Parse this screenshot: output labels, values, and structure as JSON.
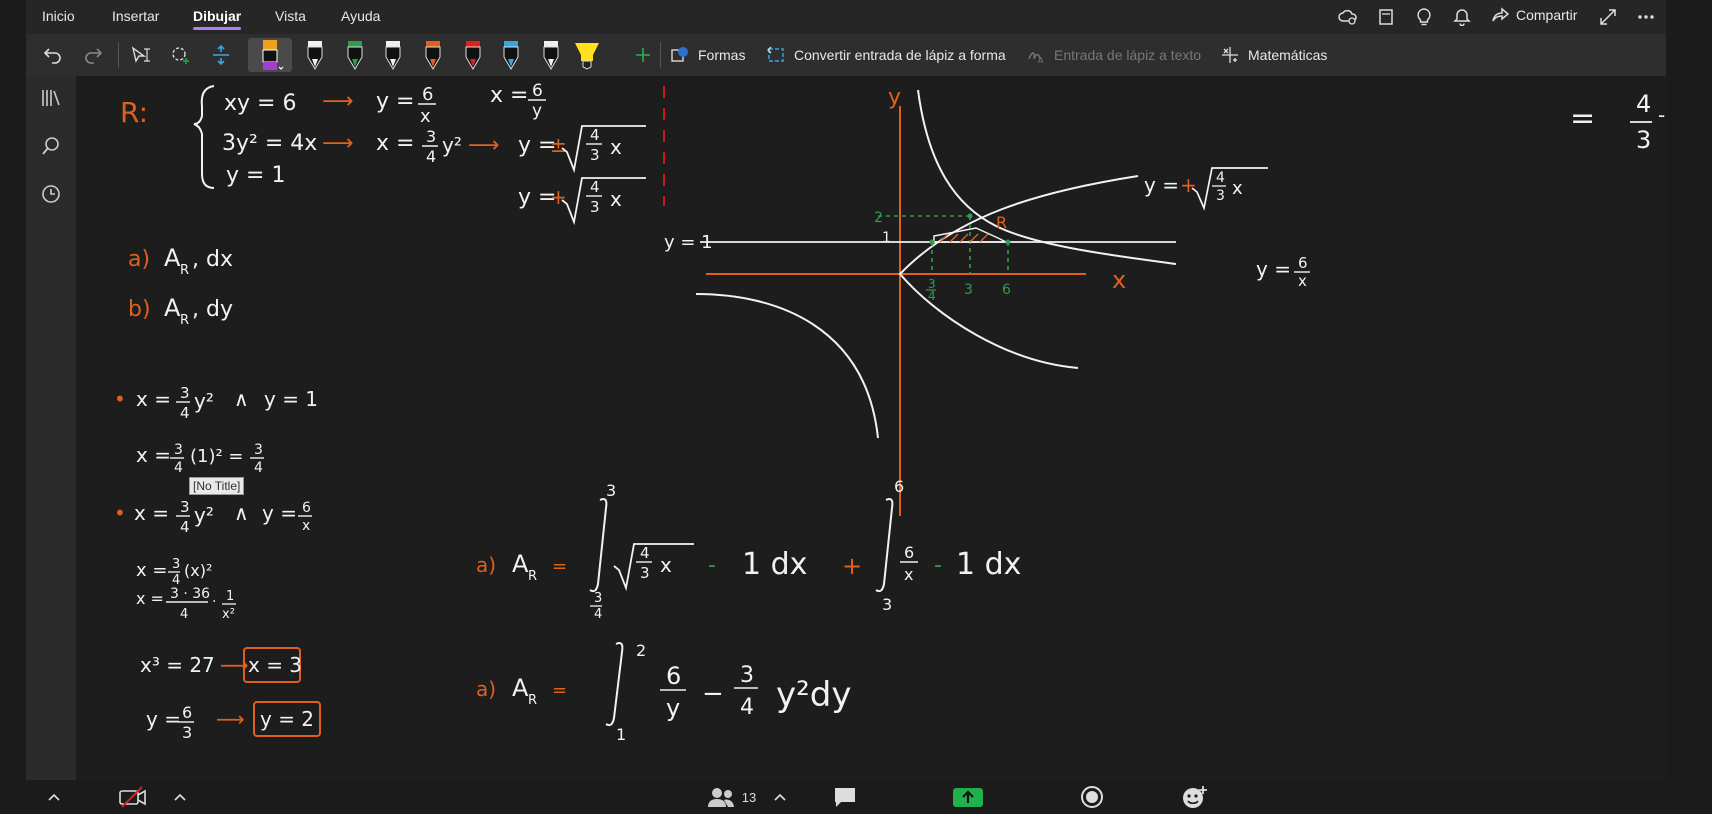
{
  "menu": {
    "tabs": [
      "Inicio",
      "Insertar",
      "Dibujar",
      "Vista",
      "Ayuda"
    ],
    "share_label": "Compartir"
  },
  "toolbar": {
    "shapes_label": "Formas",
    "ink_to_shape_label": "Convertir entrada de lápiz a forma",
    "ink_to_text_label": "Entrada de lápiz a texto",
    "math_label": "Matemáticas"
  },
  "tooltip": "[No Title]",
  "participants_count": "13",
  "pen_colors": [
    "#f0f0f0",
    "#2e9e4a",
    "#f0f0f0",
    "#e0601e",
    "#e02020",
    "#3aa6e0",
    "#f0f0f0",
    "#ffe21a"
  ],
  "ink": {
    "region_label": "R:",
    "system": [
      "xy = 6",
      "3y² = 4x",
      "y = 1"
    ],
    "arrow": "⟶",
    "sys_r1a": "y =",
    "sys_r1b": "6",
    "sys_r1c": "x",
    "sys_r1d": "x =",
    "sys_r1e": "6",
    "sys_r1f": "y",
    "sys_r2a": "x =",
    "sys_r2b": "3",
    "sys_r2c": "4",
    "sys_r2d": "y²",
    "sys_r2e": "y =",
    "sys_r2f": "±",
    "sqrt_num": "4",
    "sqrt_den": "3",
    "sqrt_var": "x",
    "sys_r3a": "y =",
    "sys_r3b": "+",
    "item_a": "a)",
    "item_a_text": "A",
    "item_a_sub": "R",
    "item_a_rest": ",  dx",
    "item_b": "b)",
    "item_b_text": "A",
    "item_b_sub": "R",
    "item_b_rest": ",  dy",
    "bullet": "•",
    "w1": "x =",
    "w1_num": "3",
    "w1_den": "4",
    "w1_y2": "y²",
    "w1_and": "∧",
    "w1_end": "y = 1",
    "w2": "x =",
    "w2_num": "3",
    "w2_den": "4",
    "w2_mid": "(1)² =",
    "w2_num2": "3",
    "w2_den2": "4",
    "w3": "x =",
    "w3_num": "3",
    "w3_den": "4",
    "w3_y2": "y²",
    "w3_and": "∧",
    "w3_ye": "y =",
    "w3_num2": "6",
    "w3_den2": "x",
    "w4": "x =",
    "w4_num": "3",
    "w4_den": "4",
    "w4_rest": "(x)²",
    "w5": "x =",
    "w5_num": "3 · 36",
    "w5_den": "4",
    "w5_mul": "·",
    "w5_num2": "1",
    "w5_den2": "x²",
    "w6": "x³ = 27",
    "w6_res": "x = 3",
    "w7": "y =",
    "w7_num": "6",
    "w7_den": "3",
    "w7_res": "y = 2",
    "g_y": "y",
    "g_x": "x",
    "g_y1": "y = 1",
    "g_2": "2",
    "g_1": "1",
    "g_R": "R",
    "g_t1": "3",
    "g_t1d": "4",
    "g_t2": "3",
    "g_t3": "6",
    "g_c1": "y =",
    "g_c1s": "+",
    "g_c2": "y =",
    "g_c2n": "6",
    "g_c2d": "x",
    "int1_lbl": "a)",
    "int1_A": "A",
    "int1_sub": "R",
    "int1_eq": "=",
    "int1_up": "3",
    "int1_lo_n": "3",
    "int1_lo_d": "4",
    "int1_minus": "-",
    "int1_one": "1 dx",
    "int1_plus": "+",
    "int1b_up": "6",
    "int1b_lo": "3",
    "int1b_n": "6",
    "int1b_d": "x",
    "int1b_rest": "1 dx",
    "int2_lbl": "a)",
    "int2_A": "A",
    "int2_sub": "R",
    "int2_eq": "=",
    "int2_up": "2",
    "int2_lo": "1",
    "int2_n": "6",
    "int2_d": "y",
    "int2_minus": "−",
    "int2_n2": "3",
    "int2_d2": "4",
    "int2_rest": "y²dy",
    "right_eq": "=",
    "right_n": "4",
    "right_d": "3",
    "right_tail": "-"
  }
}
